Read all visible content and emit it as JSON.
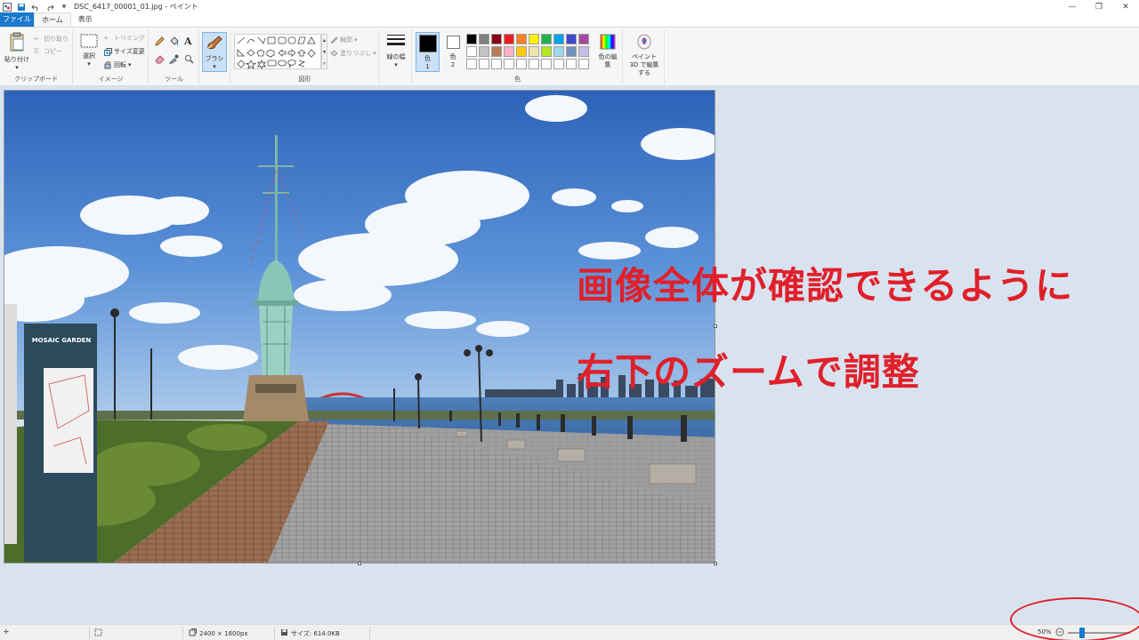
{
  "window": {
    "title": "DSC_6417_00001_01.jpg - ペイント"
  },
  "tabs": [
    {
      "label": "ファイル"
    },
    {
      "label": "ホーム"
    },
    {
      "label": "表示"
    }
  ],
  "ribbon": {
    "clipboard": {
      "paste": "貼り付け",
      "cut": "切り取り",
      "copy": "コピー",
      "group": "クリップボード"
    },
    "image": {
      "select": "選択",
      "crop": "トリミング",
      "resize": "サイズ変更",
      "rotate": "回転",
      "group": "イメージ"
    },
    "tools": {
      "group": "ツール"
    },
    "brushes": {
      "label": "ブラシ"
    },
    "shapes": {
      "outline": "輪郭",
      "fill": "塗りつぶし",
      "group": "図形"
    },
    "size": {
      "label": "線の幅"
    },
    "colors": {
      "color1": "色",
      "color1_num": "1",
      "color2": "色",
      "color2_num": "2",
      "edit": "色の編集",
      "group": "色",
      "palette_row1": [
        "#000000",
        "#7f7f7f",
        "#880015",
        "#ed1c24",
        "#ff7f27",
        "#fff200",
        "#22b14c",
        "#00a2e8",
        "#3f48cc",
        "#a349a4"
      ],
      "palette_row2": [
        "#ffffff",
        "#c3c3c3",
        "#b97a57",
        "#ffaec9",
        "#ffc90e",
        "#efe4b0",
        "#b5e61d",
        "#99d9ea",
        "#7092be",
        "#c8bfe7"
      ]
    },
    "paint3d": {
      "label": "ペイント 3D で編集する"
    }
  },
  "annotation": {
    "line1": "画像全体が確認できるように",
    "line2": "右下のズームで調整"
  },
  "statusbar": {
    "dimensions": "2400 × 1600px",
    "filesize": "サイズ: 614.0KB",
    "zoom": "50%"
  },
  "colors": {
    "accent": "#1979ca",
    "annotation_red": "#e0202a"
  }
}
